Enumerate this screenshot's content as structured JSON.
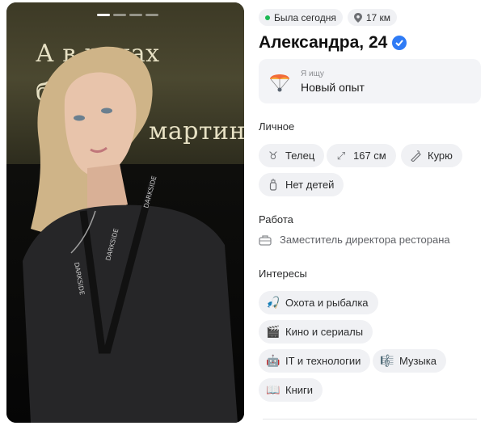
{
  "photo": {
    "poster_text_line1": "А в руках бикини",
    "poster_text_line2": "мартини",
    "lanyard_text": "DARKSIDE",
    "slides_total": 4,
    "slide_active": 1
  },
  "status": {
    "online": "Была сегодня",
    "distance": "17 км"
  },
  "profile": {
    "name_age": "Александра, 24",
    "verified_icon": "verified-check-icon"
  },
  "seeking": {
    "label": "Я ищу",
    "value": "Новый опыт",
    "icon": "parachute-icon"
  },
  "personal": {
    "title": "Личное",
    "tags": [
      {
        "icon": "taurus-icon",
        "label": "Телец"
      },
      {
        "icon": "height-arrows-icon",
        "label": "167 см"
      },
      {
        "icon": "cigarette-icon",
        "label": "Курю"
      },
      {
        "icon": "baby-bottle-icon",
        "label": "Нет детей"
      }
    ]
  },
  "work": {
    "title": "Работа",
    "icon": "briefcase-icon",
    "value": "Заместитель директора ресторана"
  },
  "interests": {
    "title": "Интересы",
    "tags": [
      {
        "icon": "fishing-icon",
        "label": "Охота и рыбалка"
      },
      {
        "icon": "clapperboard-icon",
        "label": "Кино и сериалы"
      },
      {
        "icon": "robot-icon",
        "label": "IT и технологии"
      },
      {
        "icon": "music-note-icon",
        "label": "Музыка"
      },
      {
        "icon": "book-icon",
        "label": "Книги"
      }
    ]
  },
  "colors": {
    "accent": "#2f7bf5",
    "online": "#1db954",
    "chip_bg": "#f0f1f4"
  }
}
